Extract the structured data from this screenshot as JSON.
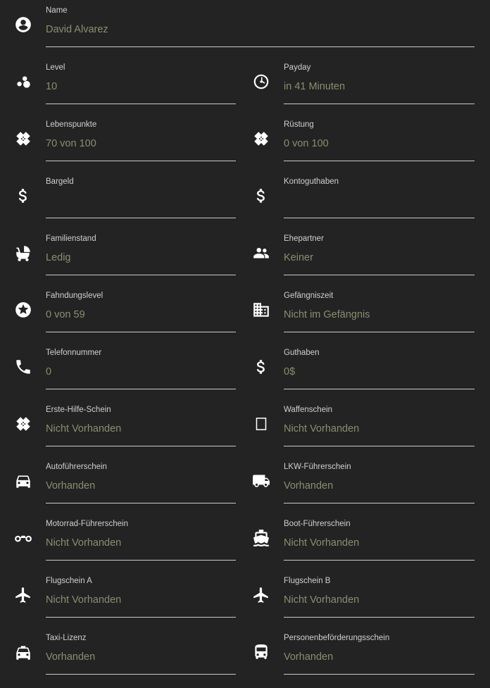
{
  "fields": {
    "name": {
      "label": "Name",
      "value": "David Alvarez"
    },
    "level": {
      "label": "Level",
      "value": "10"
    },
    "payday": {
      "label": "Payday",
      "value": "in 41 Minuten"
    },
    "lebenspunkte": {
      "label": "Lebenspunkte",
      "value": "70 von 100"
    },
    "ruestung": {
      "label": "Rüstung",
      "value": "0 von 100"
    },
    "bargeld": {
      "label": "Bargeld",
      "value": ""
    },
    "kontoguthaben": {
      "label": "Kontoguthaben",
      "value": ""
    },
    "familienstand": {
      "label": "Familienstand",
      "value": "Ledig"
    },
    "ehepartner": {
      "label": "Ehepartner",
      "value": "Keiner"
    },
    "fahndungslevel": {
      "label": "Fahndungslevel",
      "value": "0 von 59"
    },
    "gefaengniszeit": {
      "label": "Gefängniszeit",
      "value": "Nicht im Gefängnis"
    },
    "telefonnummer": {
      "label": "Telefonnummer",
      "value": "0"
    },
    "guthaben": {
      "label": "Guthaben",
      "value": "0$"
    },
    "erste_hilfe": {
      "label": "Erste-Hilfe-Schein",
      "value": "Nicht Vorhanden"
    },
    "waffenschein": {
      "label": "Waffenschein",
      "value": "Nicht Vorhanden"
    },
    "autofuehrerschein": {
      "label": "Autoführerschein",
      "value": "Vorhanden"
    },
    "lkw": {
      "label": "LKW-Führerschein",
      "value": "Vorhanden"
    },
    "motorrad": {
      "label": "Motorrad-Führerschein",
      "value": "Nicht Vorhanden"
    },
    "boot": {
      "label": "Boot-Führerschein",
      "value": "Nicht Vorhanden"
    },
    "flugschein_a": {
      "label": "Flugschein A",
      "value": "Nicht Vorhanden"
    },
    "flugschein_b": {
      "label": "Flugschein B",
      "value": "Nicht Vorhanden"
    },
    "taxi": {
      "label": "Taxi-Lizenz",
      "value": "Vorhanden"
    },
    "personen": {
      "label": "Personenbeförderungsschein",
      "value": "Vorhanden"
    }
  },
  "icons": {
    "name": "account-circle-icon",
    "level": "bubbles-icon",
    "payday": "timer-icon",
    "health": "bandage-icon",
    "money": "dollar-icon",
    "stroller": "stroller-icon",
    "partner": "people-icon",
    "star": "star-circle-icon",
    "building": "building-icon",
    "phone": "phone-icon",
    "weapon": "empty-box-icon",
    "car": "car-icon",
    "truck": "truck-icon",
    "motorbike": "motorbike-icon",
    "boat": "ship-icon",
    "plane": "airplane-icon",
    "taxi": "taxi-icon",
    "bus": "bus-icon"
  },
  "colors": {
    "background": "#232323",
    "label": "#d0d0d0",
    "value": "#8b8e6e",
    "line": "#c9c9c9",
    "icon": "#ffffff"
  }
}
